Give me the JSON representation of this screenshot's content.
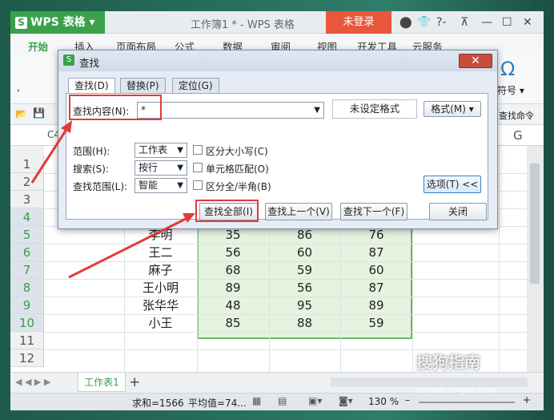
{
  "app": {
    "name": "WPS 表格",
    "doc_title": "工作簿1 * - WPS 表格",
    "login": "未登录",
    "title_icons": [
      "skin-icon",
      "shirt-icon",
      "help-icon",
      "restore-icon",
      "minimize-icon",
      "maximize-icon",
      "close-icon"
    ],
    "help": "?-"
  },
  "ribbon": {
    "tabs": [
      "开始",
      "插入",
      "页面布局",
      "公式",
      "数据",
      "审阅",
      "视图",
      "开发工具",
      "云服务"
    ],
    "fragment_symbol": "Ω",
    "fragment_label": "符号 ▾",
    "find_cmd": "查找命令"
  },
  "grid": {
    "namebox": "C4",
    "col_g": "G",
    "rows": [
      "1",
      "2",
      "3",
      "4",
      "5",
      "6",
      "7",
      "8",
      "9",
      "10",
      "11",
      "12"
    ],
    "data": [
      {
        "name": "李明",
        "a": "35",
        "b": "86",
        "c": "76"
      },
      {
        "name": "王二",
        "a": "56",
        "b": "60",
        "c": "87"
      },
      {
        "name": "麻子",
        "a": "68",
        "b": "59",
        "c": "60"
      },
      {
        "name": "王小明",
        "a": "89",
        "b": "56",
        "c": "87"
      },
      {
        "name": "张华华",
        "a": "48",
        "b": "95",
        "c": "89"
      },
      {
        "name": "小王",
        "a": "85",
        "b": "88",
        "c": "59"
      }
    ]
  },
  "sheet": {
    "tab": "工作表1",
    "add": "+"
  },
  "status": {
    "sum": "求和=1566",
    "avg": "平均值=74...",
    "zoom": "130 %"
  },
  "watermark": {
    "text": "搜狗指南",
    "url": "zhinan.sogou.com"
  },
  "dialog": {
    "title": "查找",
    "tabs": [
      "查找(D)",
      "替换(P)",
      "定位(G)"
    ],
    "find_label": "查找内容(N):",
    "find_value": "*",
    "format_display": "未设定格式",
    "format_button": "格式(M) ▾",
    "scope_label": "范围(H):",
    "scope_value": "工作表",
    "search_label": "搜索(S):",
    "search_value": "按行",
    "lookin_label": "查找范围(L):",
    "lookin_value": "智能",
    "case": "区分大小写(C)",
    "cell_match": "单元格匹配(O)",
    "width_match": "区分全/半角(B)",
    "options": "选项(T) <<",
    "find_all": "查找全部(I)",
    "find_prev": "查找上一个(V)",
    "find_next": "查找下一个(F)",
    "close": "关闭"
  },
  "colors": {
    "accent": "#3aa14a",
    "login": "#e8573d",
    "highlight": "#e23b3b",
    "selection": "#e6f3df"
  }
}
